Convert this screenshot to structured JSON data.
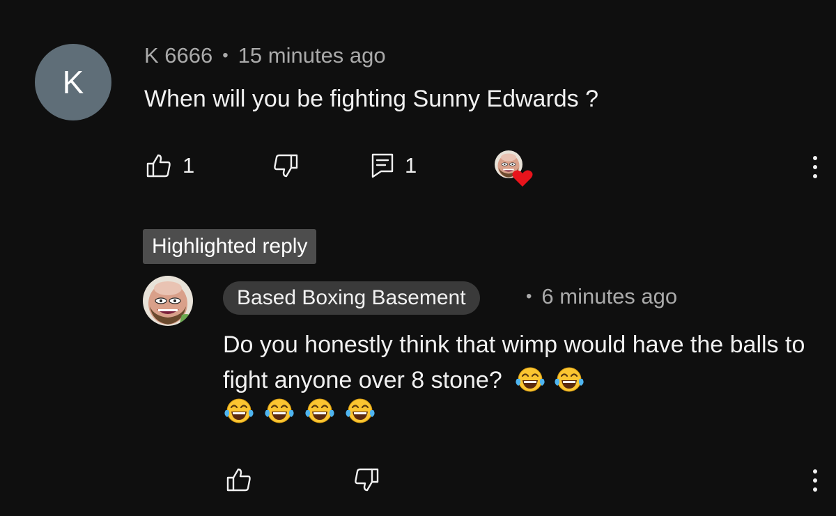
{
  "comment": {
    "avatar_letter": "K",
    "author": "K 6666",
    "separator": "•",
    "time": "15 minutes ago",
    "text": "When will you be fighting Sunny Edwards ?",
    "likes": "1",
    "replies": "1",
    "colors": {
      "avatar_bg": "#5f6e78",
      "heart": "#e8141c"
    },
    "icons": [
      "thumbs-up-icon",
      "thumbs-down-icon",
      "reply-icon",
      "creator-heart-icon",
      "more-vert-icon"
    ]
  },
  "highlight": {
    "label": "Highlighted reply"
  },
  "reply": {
    "channel": "Based Boxing Basement",
    "separator": "•",
    "time": "6 minutes ago",
    "text": "Do you honestly think that wimp would have the balls to fight anyone over 8 stone?",
    "emoji_inline_count": 2,
    "emoji_row_count": 4,
    "emoji_name": "face-with-tears-of-joy-emoji",
    "icons": [
      "thumbs-up-icon",
      "thumbs-down-icon",
      "more-vert-icon"
    ]
  }
}
